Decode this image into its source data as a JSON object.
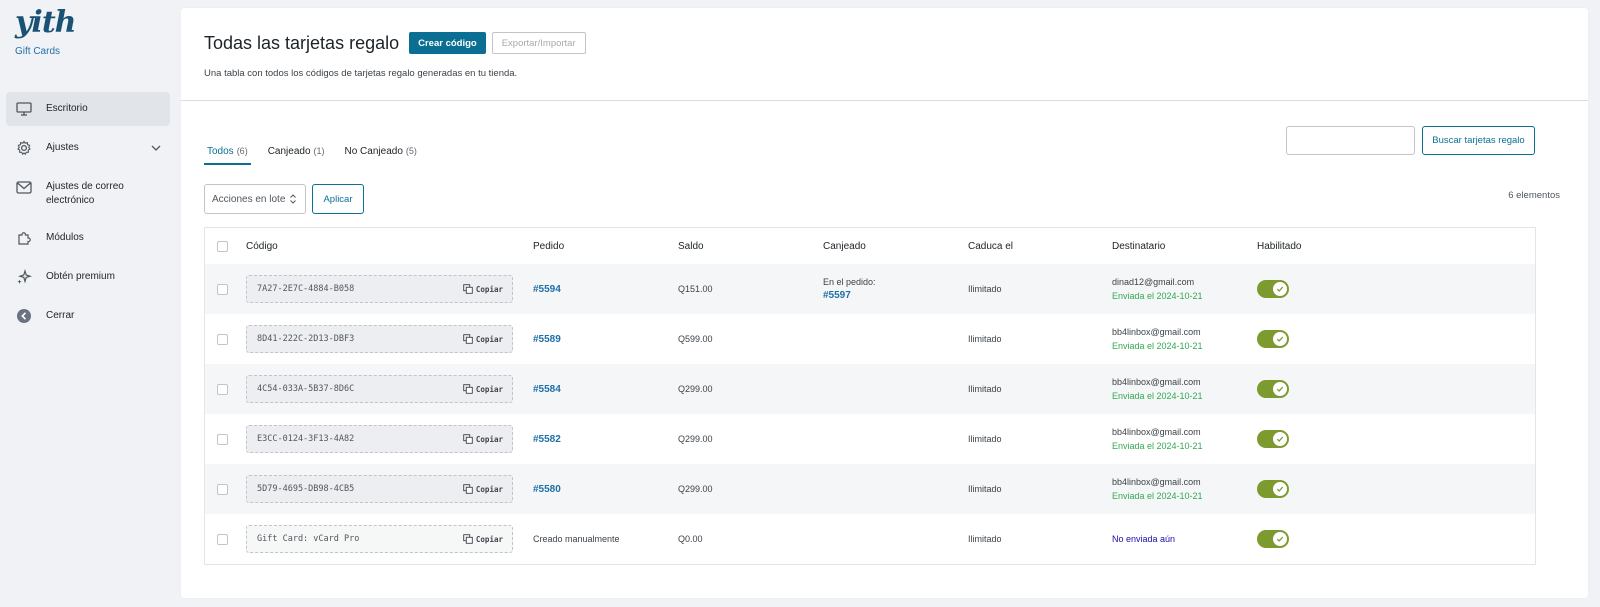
{
  "brand": {
    "logo_text": "yith",
    "product_name": "Gift Cards"
  },
  "sidebar": {
    "items": [
      {
        "label": "Escritorio",
        "icon": "monitor-icon",
        "active": true
      },
      {
        "label": "Ajustes",
        "icon": "gear-icon",
        "has_submenu": true
      },
      {
        "label": "Ajustes de correo electrónico",
        "icon": "envelope-icon"
      },
      {
        "label": "Módulos",
        "icon": "puzzle-icon"
      },
      {
        "label": "Obtén premium",
        "icon": "sparkle-icon"
      },
      {
        "label": "Cerrar",
        "icon": "arrow-left-circle-icon"
      }
    ]
  },
  "header": {
    "title": "Todas las tarjetas regalo",
    "create_label": "Crear código",
    "export_label": "Exportar/Importar",
    "description": "Una tabla con todos los códigos de tarjetas regalo generadas en tu tienda."
  },
  "tabs": [
    {
      "label": "Todos",
      "count": "(6)",
      "active": true
    },
    {
      "label": "Canjeado",
      "count": "(1)"
    },
    {
      "label": "No Canjeado",
      "count": "(5)"
    }
  ],
  "search": {
    "button_label": "Buscar tarjetas regalo",
    "value": ""
  },
  "bulk": {
    "selected": "Acciones en lote",
    "apply_label": "Aplicar"
  },
  "items_count": "6 elementos",
  "table": {
    "headers": {
      "code": "Código",
      "order": "Pedido",
      "balance": "Saldo",
      "redeemed": "Canjeado",
      "expires": "Caduca el",
      "recipient": "Destinatario",
      "enabled": "Habilitado"
    },
    "copy_label": "Copiar",
    "rows": [
      {
        "code": "7A27-2E7C-4884-B058",
        "order": "#5594",
        "balance": "Q151.00",
        "redeemed_label": "En el pedido:",
        "redeemed_order": "#5597",
        "expires": "Ilimitado",
        "recipient": "dinad12@gmail.com",
        "sent": "Enviada el 2024-10-21",
        "enabled": true
      },
      {
        "code": "8D41-222C-2D13-DBF3",
        "order": "#5589",
        "balance": "Q599.00",
        "redeemed_label": "",
        "redeemed_order": "",
        "expires": "Ilimitado",
        "recipient": "bb4linbox@gmail.com",
        "sent": "Enviada el 2024-10-21",
        "enabled": true
      },
      {
        "code": "4C54-033A-5B37-8D6C",
        "order": "#5584",
        "balance": "Q299.00",
        "redeemed_label": "",
        "redeemed_order": "",
        "expires": "Ilimitado",
        "recipient": "bb4linbox@gmail.com",
        "sent": "Enviada el 2024-10-21",
        "enabled": true
      },
      {
        "code": "E3CC-0124-3F13-4A82",
        "order": "#5582",
        "balance": "Q299.00",
        "redeemed_label": "",
        "redeemed_order": "",
        "expires": "Ilimitado",
        "recipient": "bb4linbox@gmail.com",
        "sent": "Enviada el 2024-10-21",
        "enabled": true
      },
      {
        "code": "5D79-4695-DB98-4CB5",
        "order": "#5580",
        "balance": "Q299.00",
        "redeemed_label": "",
        "redeemed_order": "",
        "expires": "Ilimitado",
        "recipient": "bb4linbox@gmail.com",
        "sent": "Enviada el 2024-10-21",
        "enabled": true
      },
      {
        "code": "Gift Card: vCard Pro",
        "order_text": "Creado manualmente",
        "balance": "Q0.00",
        "redeemed_label": "",
        "redeemed_order": "",
        "expires": "Ilimitado",
        "recipient_status": "No enviada aún",
        "enabled": true
      }
    ]
  },
  "colors": {
    "primary": "#0b6f94",
    "toggle_on": "#7c9a2e",
    "sent": "#34a853",
    "link": "#1f6fa8"
  }
}
